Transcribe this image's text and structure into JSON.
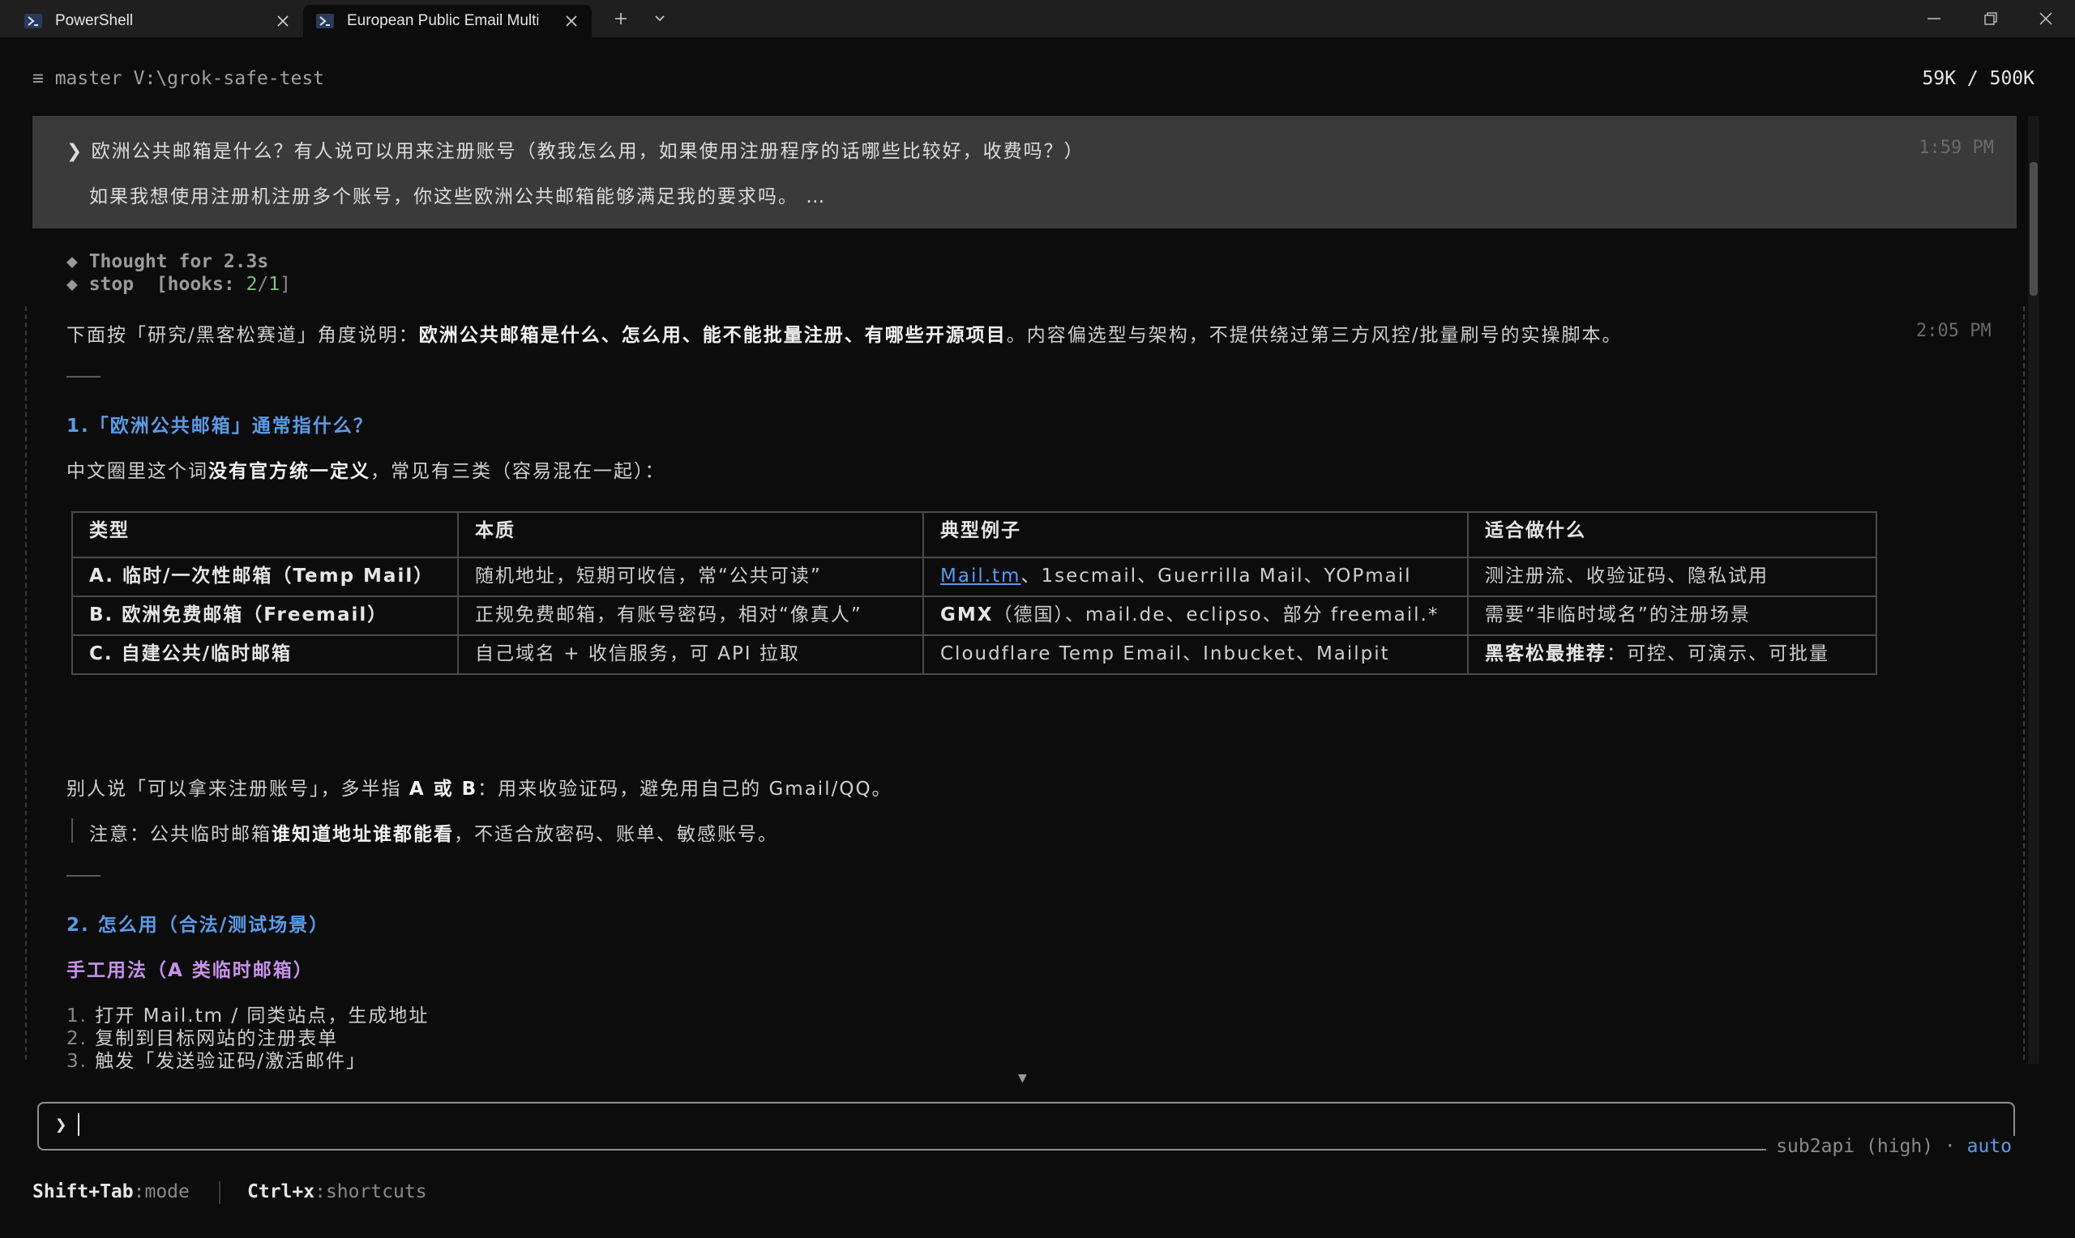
{
  "tabs": [
    {
      "label": "PowerShell",
      "icon": "powershell-icon"
    },
    {
      "label": "European Public Email Multi-/",
      "icon": "powershell-icon"
    }
  ],
  "header": {
    "branch_path": "≡ master V:\\grok-safe-test",
    "tokens": "59K / 500K"
  },
  "user_message": {
    "line1": "❯ 欧洲公共邮箱是什么？有人说可以用来注册账号（教我怎么用，如果使用注册程序的话哪些比较好，收费吗？）",
    "line2": "如果我想使用注册机注册多个账号，你这些欧洲公共邮箱能够满足我的要求吗。 …",
    "time": "1:59 PM"
  },
  "meta": {
    "thought": "◆ Thought for 2.3s",
    "stop_prefix": "◆ stop  [hooks: ",
    "stop_num": "2",
    "stop_slash": "/",
    "stop_den": "1",
    "stop_suffix": "]"
  },
  "response": {
    "time": "2:05 PM",
    "intro_a": "下面按「研究/黑客松赛道」角度说明：",
    "intro_b": "欧洲公共邮箱是什么、怎么用、能不能批量注册、有哪些开源项目",
    "intro_c": "。内容偏选型与架构，不提供绕过第三方风控/批量刷号的实操脚本。",
    "h1": "1.「欧洲公共邮箱」通常指什么？",
    "p1_a": "中文圈里这个词",
    "p1_b": "没有官方统一定义",
    "p1_c": "，常见有三类（容易混在一起）：",
    "table": {
      "headers": [
        "类型",
        "本质",
        "典型例子",
        "适合做什么"
      ],
      "rows": [
        {
          "type": "A. 临时/一次性邮箱（Temp Mail）",
          "nature": "随机地址，短期可收信，常“公共可读”",
          "ex_link": "Mail.tm",
          "ex_rest": "、1secmail、Guerrilla Mail、YOPmail",
          "use_bold": "",
          "use": "测注册流、收验证码、隐私试用"
        },
        {
          "type": "B. 欧洲免费邮箱（Freemail）",
          "nature": "正规免费邮箱，有账号密码，相对“像真人”",
          "ex_bold": "GMX",
          "ex_rest": "（德国）、mail.de、eclipso、部分 freemail.*",
          "use_bold": "",
          "use": "需要“非临时域名”的注册场景"
        },
        {
          "type": "C. 自建公共/临时邮箱",
          "nature": "自己域名 + 收信服务，可 API 拉取",
          "ex_rest": "Cloudflare Temp Email、Inbucket、Mailpit",
          "use_bold": "黑客松最推荐",
          "use": "：可控、可演示、可批量"
        }
      ]
    },
    "p2_a": "别人说「可以拿来注册账号」，多半指 ",
    "p2_b": "A 或 B",
    "p2_c": "：用来收验证码，避免用自己的 Gmail/QQ。",
    "quote_a": "注意：公共临时邮箱",
    "quote_b": "谁知道地址谁都能看",
    "quote_c": "，不适合放密码、账单、敏感账号。",
    "h2": "2. 怎么用（合法/测试场景）",
    "h3": "手工用法（A 类临时邮箱）",
    "list": [
      {
        "num": "1.",
        "text": "打开 Mail.tm / 同类站点，生成地址"
      },
      {
        "num": "2.",
        "text": "复制到目标网站的注册表单"
      },
      {
        "num": "3.",
        "text": "触发「发送验证码/激活邮件」"
      }
    ]
  },
  "input": {
    "prompt": "❯",
    "model": "sub2api (high) · ",
    "mode": "auto"
  },
  "footer": {
    "k1": "Shift+Tab",
    "v1": ":mode",
    "k2": "Ctrl+x",
    "v2": ":shortcuts"
  },
  "colors": {
    "bg": "#0c0c0c",
    "user_bg": "#3a3a3a",
    "heading_blue": "#5b9be8",
    "heading_purple": "#c792ea",
    "hook_green": "#7ec07e"
  }
}
